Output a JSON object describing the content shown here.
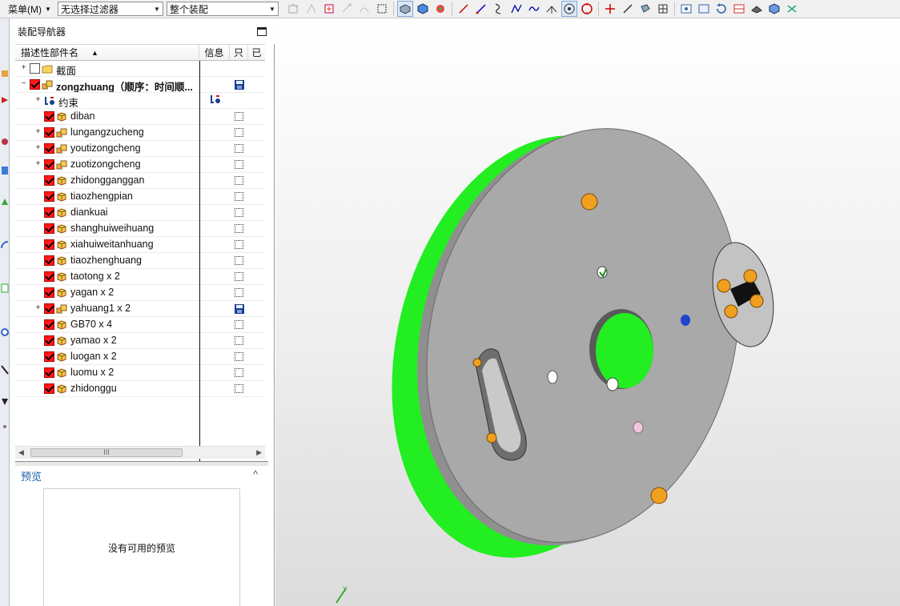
{
  "toolbar": {
    "menu_label": "菜单(M)",
    "filter_value": "无选择过滤器",
    "scope_value": "整个装配"
  },
  "navigator": {
    "title": "装配导航器",
    "columns": {
      "name": "描述性部件名",
      "info": "信息",
      "readonly": "只",
      "loaded": "已"
    },
    "rows": [
      {
        "label": "截面",
        "level": 0,
        "expandable": true,
        "checked": false,
        "icon": "folder-icon",
        "info": "",
        "readonly": "none"
      },
      {
        "label": "zongzhuang（顺序：时间顺...",
        "level": 0,
        "expandable": true,
        "expanded": true,
        "checked": true,
        "icon": "assembly-icon",
        "bold": true,
        "info": "",
        "readonly": "saved"
      },
      {
        "label": "约束",
        "level": 1,
        "expandable": true,
        "checked": false,
        "icon": "constraint-icon",
        "info": "constraint",
        "readonly": "none"
      },
      {
        "label": "diban",
        "level": 1,
        "expandable": false,
        "checked": true,
        "icon": "part-icon",
        "readonly": "box"
      },
      {
        "label": "lungangzucheng",
        "level": 1,
        "expandable": true,
        "checked": true,
        "icon": "subassembly-icon",
        "readonly": "box"
      },
      {
        "label": "youtizongcheng",
        "level": 1,
        "expandable": true,
        "checked": true,
        "icon": "subassembly-icon",
        "readonly": "box"
      },
      {
        "label": "zuotizongcheng",
        "level": 1,
        "expandable": true,
        "checked": true,
        "icon": "subassembly-icon",
        "readonly": "box"
      },
      {
        "label": "zhidongganggan",
        "level": 1,
        "expandable": false,
        "checked": true,
        "icon": "part-icon",
        "readonly": "box"
      },
      {
        "label": "tiaozhengpian",
        "level": 1,
        "expandable": false,
        "checked": true,
        "icon": "part-icon",
        "readonly": "box"
      },
      {
        "label": "diankuai",
        "level": 1,
        "expandable": false,
        "checked": true,
        "icon": "part-icon",
        "readonly": "box"
      },
      {
        "label": "shanghuiweihuang",
        "level": 1,
        "expandable": false,
        "checked": true,
        "icon": "part-icon",
        "readonly": "box"
      },
      {
        "label": "xiahuiweitanhuang",
        "level": 1,
        "expandable": false,
        "checked": true,
        "icon": "part-icon",
        "readonly": "box"
      },
      {
        "label": "tiaozhenghuang",
        "level": 1,
        "expandable": false,
        "checked": true,
        "icon": "part-icon",
        "readonly": "box"
      },
      {
        "label": "taotong x 2",
        "level": 1,
        "expandable": false,
        "checked": true,
        "icon": "part-icon",
        "readonly": "box"
      },
      {
        "label": "yagan x 2",
        "level": 1,
        "expandable": false,
        "checked": true,
        "icon": "part-icon",
        "readonly": "box"
      },
      {
        "label": "yahuang1 x 2",
        "level": 1,
        "expandable": true,
        "checked": true,
        "icon": "subassembly-icon",
        "readonly": "saved"
      },
      {
        "label": "GB70 x 4",
        "level": 1,
        "expandable": false,
        "checked": true,
        "icon": "part-icon",
        "readonly": "box"
      },
      {
        "label": "yamao x 2",
        "level": 1,
        "expandable": false,
        "checked": true,
        "icon": "part-icon",
        "readonly": "box"
      },
      {
        "label": "luogan x 2",
        "level": 1,
        "expandable": false,
        "checked": true,
        "icon": "part-icon",
        "readonly": "box"
      },
      {
        "label": "luomu x 2",
        "level": 1,
        "expandable": false,
        "checked": true,
        "icon": "part-icon",
        "readonly": "box"
      },
      {
        "label": "zhidonggu",
        "level": 1,
        "expandable": false,
        "checked": true,
        "icon": "part-icon",
        "readonly": "box"
      }
    ],
    "scroll_thumb_glyph": "III"
  },
  "preview": {
    "title": "预览",
    "collapse_glyph": "^",
    "empty_text": "没有可用的预览"
  },
  "viewport": {
    "model_colors": {
      "rim": "#22ee22",
      "face": "#a9a9a9",
      "pins": "#f0a020",
      "slider": "#111111"
    },
    "triad_label": "Y"
  }
}
